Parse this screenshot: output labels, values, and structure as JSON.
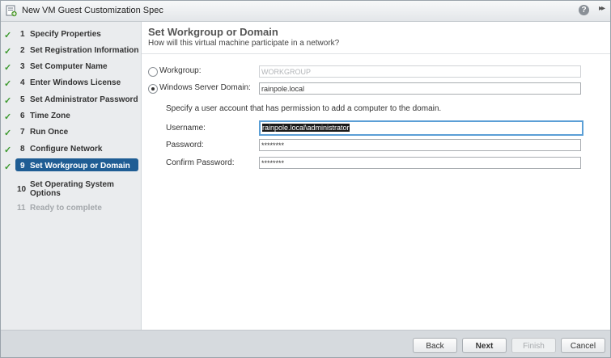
{
  "window": {
    "title": "New VM Guest Customization Spec",
    "help_label": "?",
    "expand_label": "▸▸"
  },
  "steps": [
    {
      "num": "1",
      "label": "Specify Properties",
      "state": "done"
    },
    {
      "num": "2",
      "label": "Set Registration Information",
      "state": "done"
    },
    {
      "num": "3",
      "label": "Set Computer Name",
      "state": "done"
    },
    {
      "num": "4",
      "label": "Enter Windows License",
      "state": "done"
    },
    {
      "num": "5",
      "label": "Set Administrator Password",
      "state": "done"
    },
    {
      "num": "6",
      "label": "Time Zone",
      "state": "done"
    },
    {
      "num": "7",
      "label": "Run Once",
      "state": "done"
    },
    {
      "num": "8",
      "label": "Configure Network",
      "state": "done"
    },
    {
      "num": "9",
      "label": "Set Workgroup or Domain",
      "state": "active"
    },
    {
      "num": "10",
      "label": "Set Operating System Options",
      "state": "pending"
    },
    {
      "num": "11",
      "label": "Ready to complete",
      "state": "disabled"
    }
  ],
  "page": {
    "title": "Set Workgroup or Domain",
    "subtitle": "How will this virtual machine participate in a network?",
    "workgroup_label": "Workgroup:",
    "workgroup_value": "WORKGROUP",
    "domain_label": "Windows Server Domain:",
    "domain_value": "rainpole.local",
    "account_instruction": "Specify a user account that has permission to add a computer to the domain.",
    "username_label": "Username:",
    "username_value": "rainpole.local\\administrator",
    "password_label": "Password:",
    "password_value": "********",
    "confirm_label": "Confirm Password:",
    "confirm_value": "********",
    "selected_option": "domain"
  },
  "footer": {
    "back": "Back",
    "next": "Next",
    "finish": "Finish",
    "cancel": "Cancel"
  },
  "colors": {
    "active_step": "#1f5d94",
    "check": "#3c9a2e",
    "focus": "#5b9fd6"
  }
}
